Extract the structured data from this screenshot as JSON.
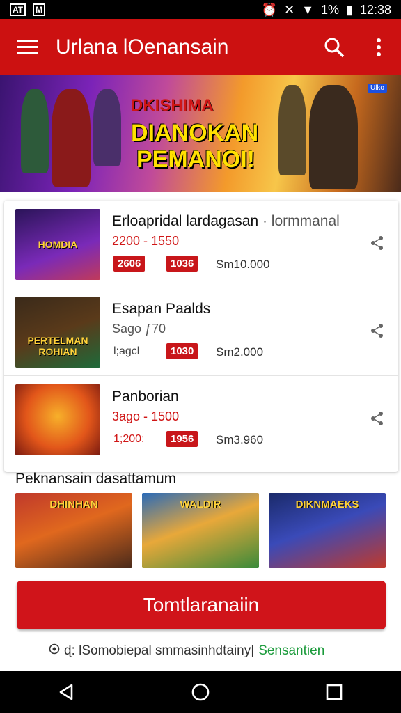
{
  "status_bar": {
    "left_badge_1": "AT",
    "left_badge_2": "M",
    "battery": "1%",
    "time": "12:38"
  },
  "app_bar": {
    "title": "Urlana lOenansain"
  },
  "banner": {
    "line1": "DKISHIMA",
    "line2": "DIANOKAN",
    "line3": "PEMANOI!",
    "badge": "Ulko"
  },
  "list": [
    {
      "thumb_title": "HOMDIA",
      "name": "Erloapridal lardagasan",
      "tag": " · lormmanal",
      "price": "2200 - 1550",
      "chip1": "2606",
      "chip1_red": true,
      "chip2": "1036",
      "sm": "Sm10.000"
    },
    {
      "thumb_title": "PERTELMAN ROHIAN",
      "name": "Esapan Paalds",
      "tag": "",
      "price": "Sago ƒ70",
      "chip1": "l;agcl",
      "chip1_red": false,
      "chip2": "1030",
      "sm": "Sm2.000"
    },
    {
      "thumb_title": "",
      "name": "Panborian",
      "tag": "",
      "price": "3ago - 1500",
      "chip1": "1;200:",
      "chip1_red": false,
      "chip2": "1956",
      "sm": "Sm3.960"
    }
  ],
  "section_title": "Peknansain dasattamum",
  "tiles": [
    {
      "title": "DHINHAN"
    },
    {
      "title": "WALDIR"
    },
    {
      "title": "DIKNMAEKS"
    }
  ],
  "cta": {
    "label": "Tomtlaranaiin"
  },
  "footer": {
    "text": "ɖ: lSomobiepal smmasinhdtainy|",
    "link": "Sensantien"
  },
  "colors": {
    "primary": "#cc1111",
    "link_green": "#1a9a3a"
  },
  "icons": [
    "menu-icon",
    "search-icon",
    "more-vert-icon",
    "share-icon",
    "back-icon",
    "home-icon",
    "recents-icon",
    "radio-icon"
  ]
}
